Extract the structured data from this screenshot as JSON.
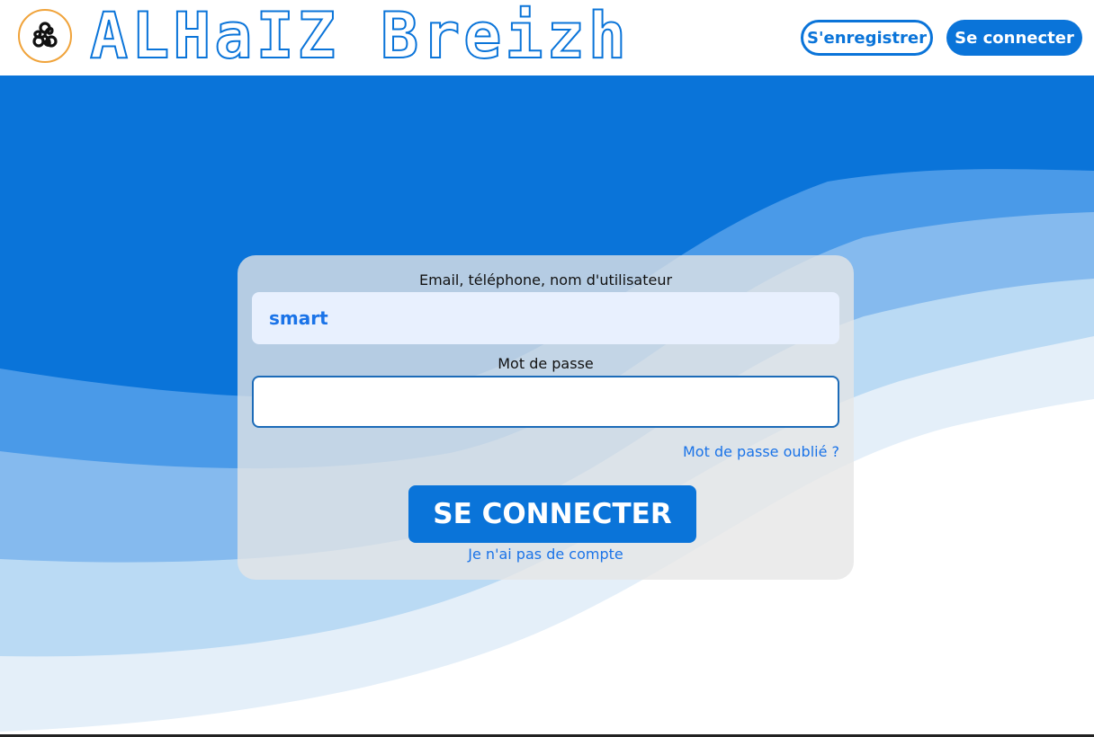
{
  "header": {
    "brand": "ALHaIZ Breizh",
    "register_label": "S'enregistrer",
    "login_label": "Se connecter"
  },
  "login_form": {
    "identifier_label": "Email, téléphone, nom d'utilisateur",
    "identifier_value": "smart",
    "password_label": "Mot de passe",
    "password_value": "",
    "forgot_link": "Mot de passe oublié ?",
    "submit_label": "SE CONNECTER",
    "no_account_link": "Je n'ai pas de compte"
  },
  "icons": {
    "logo": "triskelion-icon"
  },
  "colors": {
    "primary": "#0a74d9",
    "wave_1": "#4a9ae8",
    "wave_2": "#85baee",
    "wave_3": "#badaf4",
    "wave_4": "#e4eff9",
    "logo_ring": "#f0a33a"
  }
}
